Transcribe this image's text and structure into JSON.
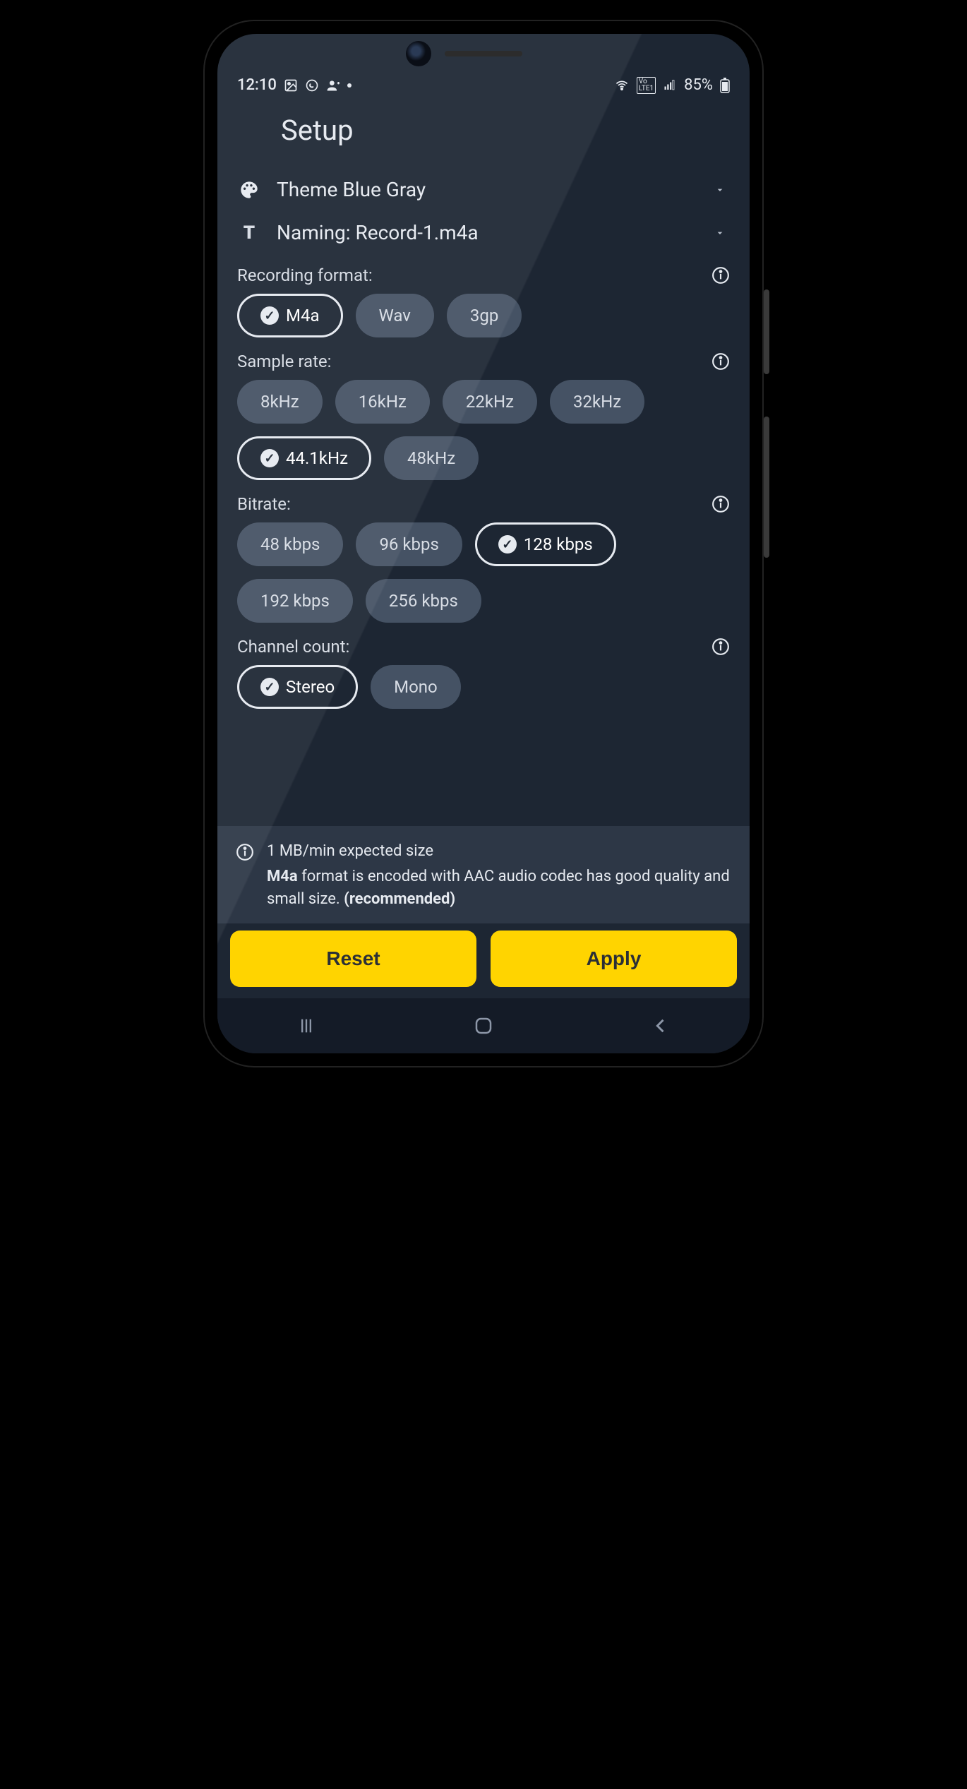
{
  "status": {
    "time": "12:10",
    "battery_text": "85%"
  },
  "page": {
    "title": "Setup"
  },
  "theme_row": {
    "label": "Theme Blue Gray"
  },
  "naming_row": {
    "label": "Naming: Record-1.m4a"
  },
  "format": {
    "title": "Recording format:",
    "options": [
      "M4a",
      "Wav",
      "3gp"
    ],
    "selected": "M4a"
  },
  "sample_rate": {
    "title": "Sample rate:",
    "options": [
      "8kHz",
      "16kHz",
      "22kHz",
      "32kHz",
      "44.1kHz",
      "48kHz"
    ],
    "selected": "44.1kHz"
  },
  "bitrate": {
    "title": "Bitrate:",
    "options": [
      "48 kbps",
      "96 kbps",
      "128 kbps",
      "192 kbps",
      "256 kbps"
    ],
    "selected": "128 kbps"
  },
  "channel": {
    "title": "Channel count:",
    "options": [
      "Stereo",
      "Mono"
    ],
    "selected": "Stereo"
  },
  "footer": {
    "expected_size": "1 MB/min expected size",
    "format_name": "M4a",
    "desc_mid": " format is encoded with AAC audio codec has good quality and small size. ",
    "recommended": "(recommended)"
  },
  "actions": {
    "reset": "Reset",
    "apply": "Apply"
  }
}
